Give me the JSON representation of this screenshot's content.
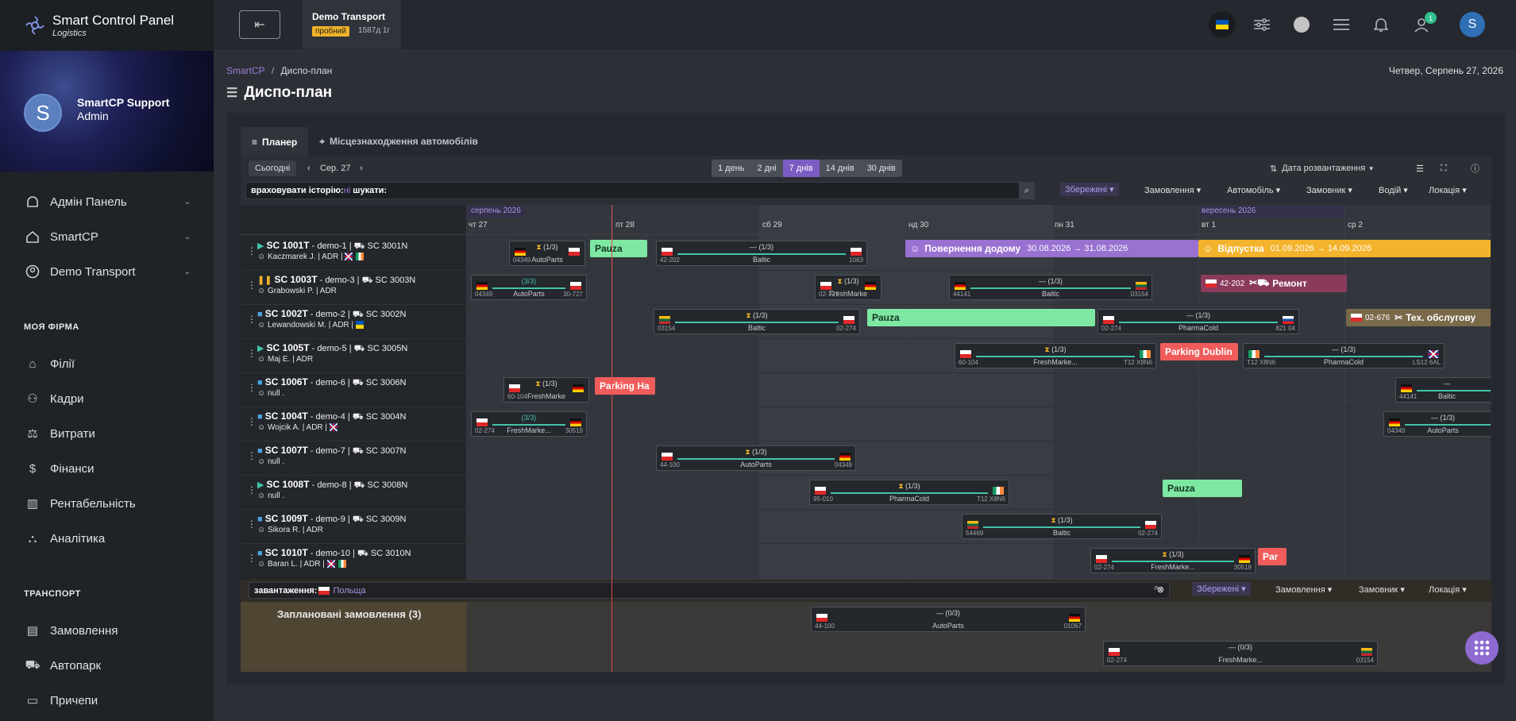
{
  "app": {
    "name": "Smart Control Panel",
    "subtitle": "Logistics"
  },
  "profile": {
    "avatar": "S",
    "name": "SmartCP Support",
    "role": "Admin"
  },
  "nav_top": [
    {
      "label": "Адмін Панель",
      "icon": "admin-icon"
    },
    {
      "label": "SmartCP",
      "icon": "home-icon"
    },
    {
      "label": "Demo Transport",
      "icon": "user-circle-icon"
    }
  ],
  "sections": {
    "firm": "МОЯ ФІРМА",
    "transport": "ТРАНСПОРТ"
  },
  "nav_firm": [
    {
      "label": "Філії"
    },
    {
      "label": "Кадри"
    },
    {
      "label": "Витрати"
    },
    {
      "label": "Фінанси"
    },
    {
      "label": "Рентабельність"
    },
    {
      "label": "Аналітика"
    }
  ],
  "nav_transport": [
    {
      "label": "Замовлення"
    },
    {
      "label": "Автопарк"
    },
    {
      "label": "Причепи"
    }
  ],
  "company": {
    "name": "Demo Transport",
    "badge": "пробний",
    "days": "1587д 1г"
  },
  "topbar": {
    "notifications_badge": "1",
    "user_avatar": "S",
    "back_icon": "⇤"
  },
  "breadcrumb": {
    "root": "SmartCP",
    "sep": "/",
    "current": "Диспо-план"
  },
  "date": "Четвер, Серпень 27, 2026",
  "page_title": "Диспо-план",
  "tabs": [
    "Планер",
    "Місцезнаходження автомобілів"
  ],
  "toolbar": {
    "today": "Сьогодні",
    "current_date": "Сер. 27",
    "ranges": [
      "1 день",
      "2 дні",
      "7 днів",
      "14 днів",
      "30 днів"
    ],
    "active_range": "7 днів",
    "sort": "Дата розвантаження"
  },
  "search1": {
    "prefix": "враховувати історію:",
    "toggle": "ні",
    "label": "шукати:"
  },
  "filters1": [
    "Збережені",
    "Замовлення",
    "Автомобіль",
    "Замовник",
    "Водій",
    "Локація"
  ],
  "months": [
    "серпень 2026",
    "вересень 2026"
  ],
  "days": [
    "чт 27",
    "пт 28",
    "сб 29",
    "нд 30",
    "пн 31",
    "вт 1",
    "ср 2"
  ],
  "vehicles": [
    {
      "id": "SC 1001T",
      "demo": "demo-1",
      "trailer": "SC 3001N",
      "driver": "Kaczmarek J. | ADR |"
    },
    {
      "id": "SC 1003T",
      "demo": "demo-3",
      "trailer": "SC 3003N",
      "driver": "Grabowski P. | ADR"
    },
    {
      "id": "SC 1002T",
      "demo": "demo-2",
      "trailer": "SC 3002N",
      "driver": "Lewandowski M. | ADR |"
    },
    {
      "id": "SC 1005T",
      "demo": "demo-5",
      "trailer": "SC 3005N",
      "driver": "Maj E. | ADR"
    },
    {
      "id": "SC 1006T",
      "demo": "demo-6",
      "trailer": "SC 3006N",
      "driver": "null ."
    },
    {
      "id": "SC 1004T",
      "demo": "demo-4",
      "trailer": "SC 3004N",
      "driver": "Wojcik A. | ADR |"
    },
    {
      "id": "SC 1007T",
      "demo": "demo-7",
      "trailer": "SC 3007N",
      "driver": "null ."
    },
    {
      "id": "SC 1008T",
      "demo": "demo-8",
      "trailer": "SC 3008N",
      "driver": "null ."
    },
    {
      "id": "SC 1009T",
      "demo": "demo-9",
      "trailer": "SC 3009N",
      "driver": "Sikora R. | ADR"
    },
    {
      "id": "SC 1010T",
      "demo": "demo-10",
      "trailer": "SC 3010N",
      "driver": "Baran L. | ADR |"
    }
  ],
  "events": {
    "pauza": "Pauza",
    "park_dublin": "Parking Dublin",
    "park_ha": "Parking Ha",
    "par": "Par",
    "return": "Повернення додому",
    "return_dates": "30.08.2026 → 31.08.2026",
    "vacation": "Відпустка",
    "vacation_dates": "01.09.2026 → 14.09.2026",
    "repair": "Ремонт",
    "repair_code": "42-202",
    "service": "Тех. обслугову",
    "service_code": "02-676"
  },
  "trips": {
    "baltic": "Baltic",
    "autoparts": "AutoParts",
    "pharmacold": "PharmaCold",
    "freshmarke": "FreshMarke...",
    "freshmark": "FreshMarke",
    "freshm": "FreshMarke",
    "r13": "(1/3)",
    "r33": "(3/3)",
    "r03": "(0/3)",
    "dash": "—",
    "c42202": "42-202",
    "c1063": "1063",
    "c04349": "04349",
    "c30727": "30-727",
    "c44141": "44141",
    "c03154": "03154",
    "c02274": "02-274",
    "c82104": "821 04",
    "c60104": "60-104",
    "cT12X8N6": "T12 X8N6",
    "cLS12": "LS12 6AL",
    "c02727": "02-727",
    "c30519": "30519",
    "c44100": "44-100",
    "c95010": "95-010",
    "c54469": "54469",
    "c01067": "01067"
  },
  "search3": {
    "label": "завантаження:",
    "country": "Польща"
  },
  "filters3": [
    "Збережені",
    "Замовлення",
    "Замовник",
    "Локація"
  ],
  "orders": {
    "title": "Заплановані замовлення (3)"
  }
}
